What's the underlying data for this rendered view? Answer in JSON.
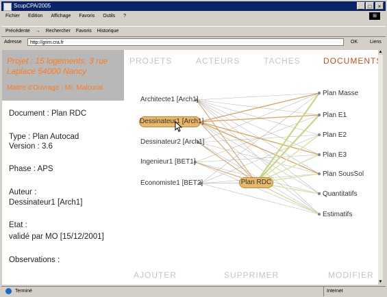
{
  "window": {
    "title": "ScupCPA/2005"
  },
  "menubar": {
    "items": [
      "Fichier",
      "Edition",
      "Affichage",
      "Favoris",
      "Outils",
      "?"
    ]
  },
  "toolbar": {
    "back": "Précédente",
    "forward": "→",
    "search": "Rechercher",
    "favorites": "Favoris",
    "history": "Historique"
  },
  "addressbar": {
    "label": "Adresse",
    "url": "http://grim.cra.fr",
    "go": "OK",
    "links": "Liens"
  },
  "left": {
    "project": "Projet : 15 logements, 3 rue Laplace 54000 Nancy",
    "owner": "Maitre d'Ouvrage : Mr. Malcurat",
    "document": "Document : Plan RDC",
    "type": "Type : Plan Autocad",
    "version": "Version : 3.6",
    "phase": "Phase : APS",
    "author_label": "Auteur :",
    "author_value": "Dessinateur1 [Arch1]",
    "state_label": "Etat :",
    "state_value": "validé par MO [15/12/2001]",
    "observations": "Observations :"
  },
  "tabs": [
    "PROJETS",
    "ACTEURS",
    "TACHES",
    "DOCUMENTS"
  ],
  "actions": {
    "add": "AJOUTER",
    "remove": "SUPPRIMER",
    "edit": "MODIFIER"
  },
  "actors": [
    "Architecte1 [Arch1]",
    "Dessinateur1 [Arch1]",
    "Dessinateur2 [Arch1]",
    "Ingenieur1 [BET1]",
    "Economiste1 [BET2]"
  ],
  "center_node": "Plan RDC",
  "documents": [
    "Plan Masse",
    "Plan E1",
    "Plan E2",
    "Plan E3",
    "Plan SousSol",
    "Quantitatifs",
    "Estimatifs"
  ],
  "colors": {
    "accent": "#ff7b1c",
    "active_tab": "#c84e1c",
    "highlight": "#e8b868",
    "inactive": "#c4c4c4"
  },
  "status": {
    "text": "Terminé",
    "zone": "Internet"
  }
}
